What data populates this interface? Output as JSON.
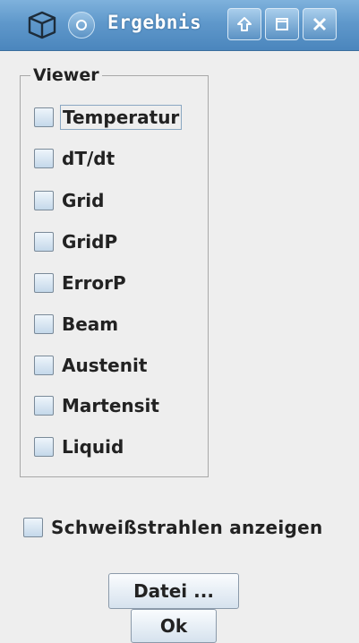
{
  "window": {
    "title": "Ergebnis",
    "icons": {
      "app": "cube-icon",
      "menu": "circle-menu-icon",
      "up": "arrow-up-icon",
      "maximize": "maximize-icon",
      "close": "close-icon"
    },
    "colors": {
      "titlebar": "#5f98cb",
      "background": "#eeeeee"
    }
  },
  "viewer": {
    "legend": "Viewer",
    "items": [
      {
        "label": "Temperatur",
        "checked": false,
        "focused": true
      },
      {
        "label": "dT/dt",
        "checked": false
      },
      {
        "label": "Grid",
        "checked": false
      },
      {
        "label": "GridP",
        "checked": false
      },
      {
        "label": "ErrorP",
        "checked": false
      },
      {
        "label": "Beam",
        "checked": false
      },
      {
        "label": "Austenit",
        "checked": false
      },
      {
        "label": "Martensit",
        "checked": false
      },
      {
        "label": "Liquid",
        "checked": false
      }
    ]
  },
  "options": {
    "weld_beams_label": "Schweißstrahlen anzeigen",
    "weld_beams_checked": false
  },
  "buttons": {
    "file_label": "Datei ...",
    "ok_label": "Ok"
  }
}
